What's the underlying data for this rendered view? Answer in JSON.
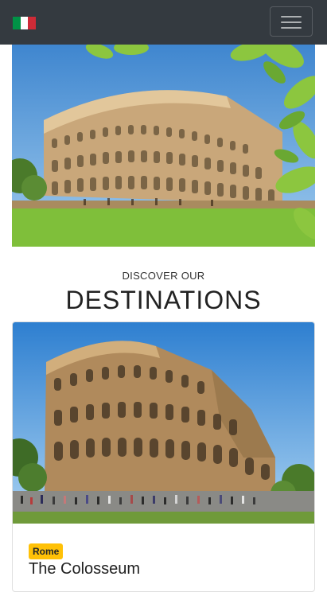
{
  "navbar": {
    "flag_colors": [
      "#009246",
      "#ffffff",
      "#ce2b37"
    ],
    "toggle_icon": "hamburger-icon"
  },
  "hero": {
    "image": "colosseum-with-green-leaves"
  },
  "section": {
    "eyebrow": "DISCOVER OUR",
    "title": "DESTINATIONS"
  },
  "cards": [
    {
      "image": "colosseum-with-crowd",
      "badge": "Rome",
      "badge_color": "#ffc107",
      "title": "The Colosseum"
    }
  ]
}
